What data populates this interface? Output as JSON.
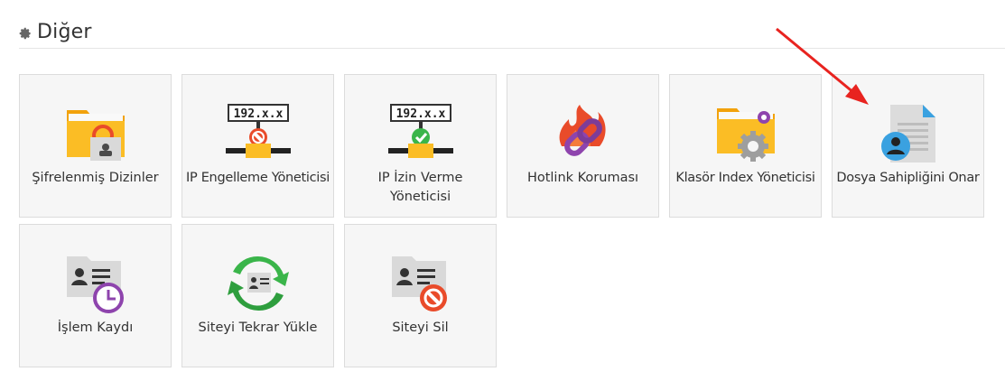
{
  "section": {
    "title": "Diğer",
    "icon": "gear-icon"
  },
  "tiles": [
    {
      "label": "Şifrelenmiş Dizinler",
      "icon": "encrypted-folder-icon"
    },
    {
      "label": "IP Engelleme Yöneticisi",
      "icon": "ip-block-icon",
      "ip_text": "192.x.x"
    },
    {
      "label": "IP İzin Verme Yöneticisi",
      "icon": "ip-allow-icon",
      "ip_text": "192.x.x"
    },
    {
      "label": "Hotlink Koruması",
      "icon": "hotlink-icon"
    },
    {
      "label": "Klasör Index Yöneticisi",
      "icon": "folder-settings-icon"
    },
    {
      "label": "Dosya Sahipliğini Onar",
      "icon": "file-owner-icon"
    },
    {
      "label": "İşlem Kaydı",
      "icon": "activity-log-icon"
    },
    {
      "label": "Siteyi Tekrar Yükle",
      "icon": "reload-site-icon"
    },
    {
      "label": "Siteyi Sil",
      "icon": "delete-site-icon"
    }
  ],
  "colors": {
    "annotation_arrow": "#e8231f",
    "tile_bg": "#f6f6f6",
    "tile_border": "#dcdcdc"
  }
}
